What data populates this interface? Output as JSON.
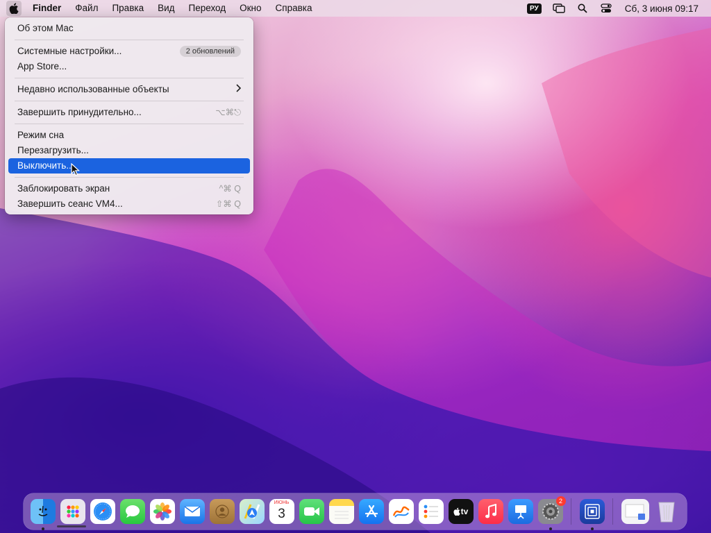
{
  "menubar": {
    "app_name": "Finder",
    "items": [
      "Файл",
      "Правка",
      "Вид",
      "Переход",
      "Окно",
      "Справка"
    ],
    "input_source": "РУ",
    "clock": "Сб, 3 июня  09:17"
  },
  "apple_menu": {
    "about": "Об этом Mac",
    "system_settings": "Системные настройки...",
    "updates_badge": "2 обновлений",
    "app_store": "App Store...",
    "recent_items": "Недавно использованные объекты",
    "force_quit": "Завершить принудительно...",
    "force_quit_shortcut": "⌥⌘⎋",
    "sleep": "Режим сна",
    "restart": "Перезагрузить...",
    "shutdown": "Выключить...",
    "lock_screen": "Заблокировать экран",
    "lock_shortcut": "^⌘ Q",
    "log_out": "Завершить сеанс VM4...",
    "log_out_shortcut": "⇧⌘ Q"
  },
  "dock": {
    "calendar_month": "ИЮНЬ",
    "calendar_day": "3",
    "settings_badge": "2",
    "tv_label": "tv"
  }
}
